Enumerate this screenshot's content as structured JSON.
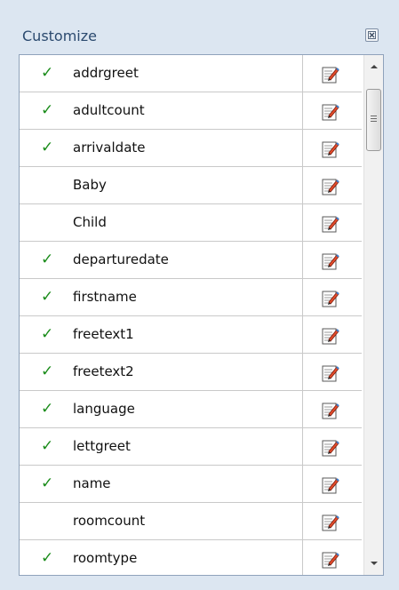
{
  "panel": {
    "title": "Customize",
    "close_icon": "close-icon"
  },
  "fields": [
    {
      "name": "addrgreet",
      "checked": true
    },
    {
      "name": "adultcount",
      "checked": true
    },
    {
      "name": "arrivaldate",
      "checked": true
    },
    {
      "name": "Baby",
      "checked": false
    },
    {
      "name": "Child",
      "checked": false
    },
    {
      "name": "departuredate",
      "checked": true
    },
    {
      "name": "firstname",
      "checked": true
    },
    {
      "name": "freetext1",
      "checked": true
    },
    {
      "name": "freetext2",
      "checked": true
    },
    {
      "name": "language",
      "checked": true
    },
    {
      "name": "lettgreet",
      "checked": true
    },
    {
      "name": "name",
      "checked": true
    },
    {
      "name": "roomcount",
      "checked": false
    },
    {
      "name": "roomtype",
      "checked": true
    }
  ],
  "check_glyph": "✓",
  "colors": {
    "check": "#1a8c1a",
    "accent": "#2b4a6f"
  }
}
